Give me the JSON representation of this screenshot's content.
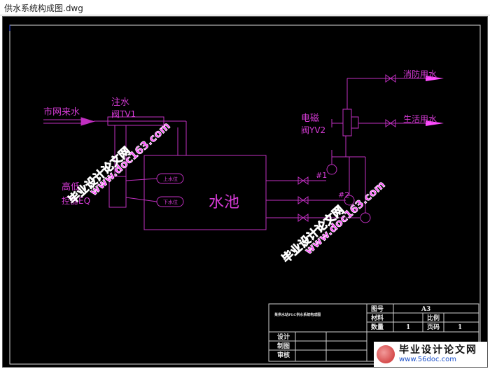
{
  "window": {
    "title": "供水系统构成图.dwg"
  },
  "drawing": {
    "labels": {
      "city_water": "市网来水",
      "fill_valve_line1": "注水",
      "fill_valve_line2": "阀TV1",
      "level_ctrl_line1": "高低",
      "level_ctrl_line2": "控器EQ",
      "solenoid_line1": "电磁",
      "solenoid_line2": "阀YV2",
      "pool": "水池",
      "upper_level": "上水位",
      "lower_level": "下水位",
      "pump1": "#1",
      "pump2": "#2",
      "fire_water": "消防用水",
      "domestic_water": "生活用水"
    },
    "title_block": {
      "drawing_name": "某供水站PLC供水系统构成图",
      "drawing_no_label": "图号",
      "drawing_no": "A3",
      "material_label": "材料",
      "scale_label": "比例",
      "quantity_label": "数量",
      "quantity": "1",
      "page_label": "页码",
      "page": "1",
      "design_label": "设计",
      "draw_label": "制图",
      "review_label": "审核"
    },
    "watermarks": {
      "line_cn": "毕业设计论文网",
      "line_url": "www.doc163.com",
      "footer_cn": "毕业设计论文网",
      "footer_url": "www.56doc.com"
    },
    "colors": {
      "line": "#c02fc0",
      "pipe": "#ff4cff",
      "wm": "#ff3cff",
      "frame": "#e0e0e0"
    }
  }
}
